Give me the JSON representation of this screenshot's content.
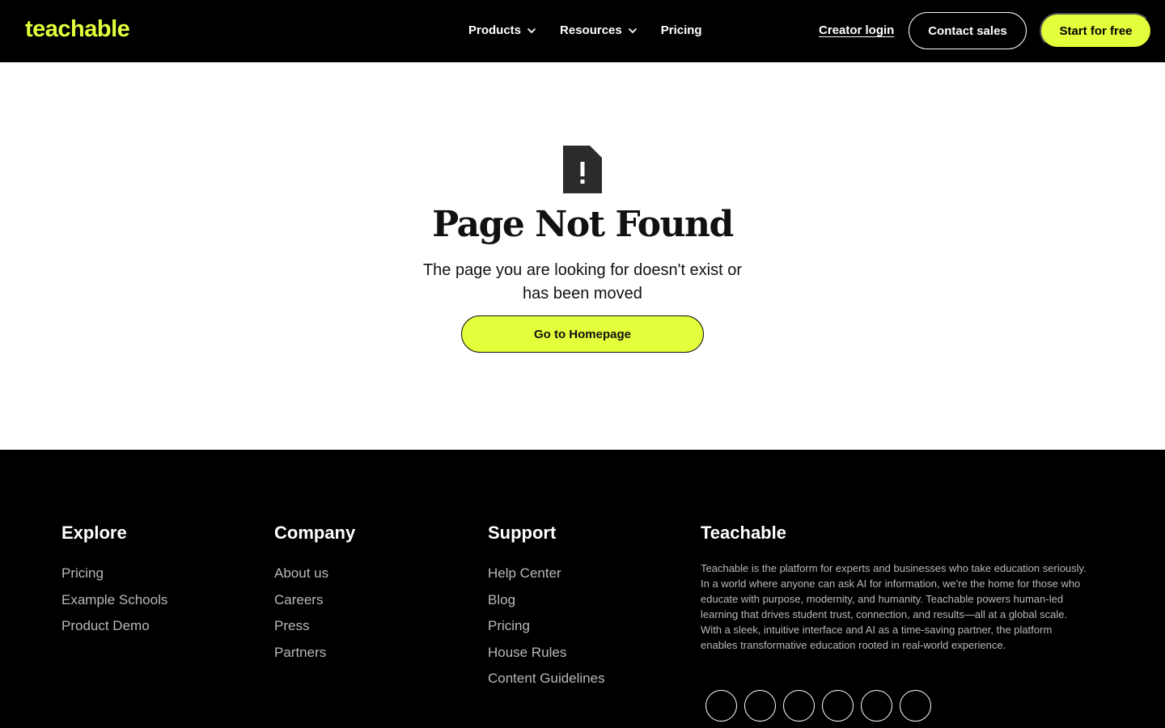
{
  "header": {
    "logo": "teachable",
    "nav": [
      {
        "label": "Products",
        "has_dropdown": true
      },
      {
        "label": "Resources",
        "has_dropdown": true
      },
      {
        "label": "Pricing",
        "has_dropdown": false
      }
    ],
    "login": "Creator login",
    "contact": "Contact sales",
    "cta": "Start for free"
  },
  "main": {
    "icon": "document-alert-icon",
    "title": "Page Not Found",
    "subtitle": "The page you are looking for doesn't exist or has been moved",
    "button": "Go to Homepage"
  },
  "footer": {
    "explore": {
      "heading": "Explore",
      "links": [
        "Pricing",
        "Example Schools",
        "Product Demo"
      ]
    },
    "company": {
      "heading": "Company",
      "links": [
        "About us",
        "Careers",
        "Press",
        "Partners"
      ]
    },
    "support": {
      "heading": "Support",
      "links": [
        "Help Center",
        "Blog",
        "Pricing",
        "House Rules",
        "Content Guidelines"
      ]
    },
    "about": {
      "heading": "Teachable",
      "text": "Teachable is the platform for experts and businesses who take education seriously. In a world where anyone can ask AI for information, we're the home for those who educate with purpose, modernity, and humanity. Teachable powers human-led learning that drives student trust, connection, and results—all at a global scale. With a sleek, intuitive interface and AI as a time-saving partner, the platform enables transformative education rooted in real-world experience."
    },
    "social_icons": [
      "social-icon-1",
      "social-icon-2",
      "social-icon-3",
      "social-icon-4",
      "social-icon-5",
      "social-icon-6"
    ]
  },
  "colors": {
    "brand_lime": "#e3ff3b",
    "header_bg": "#000000",
    "footer_bg": "#000000"
  }
}
